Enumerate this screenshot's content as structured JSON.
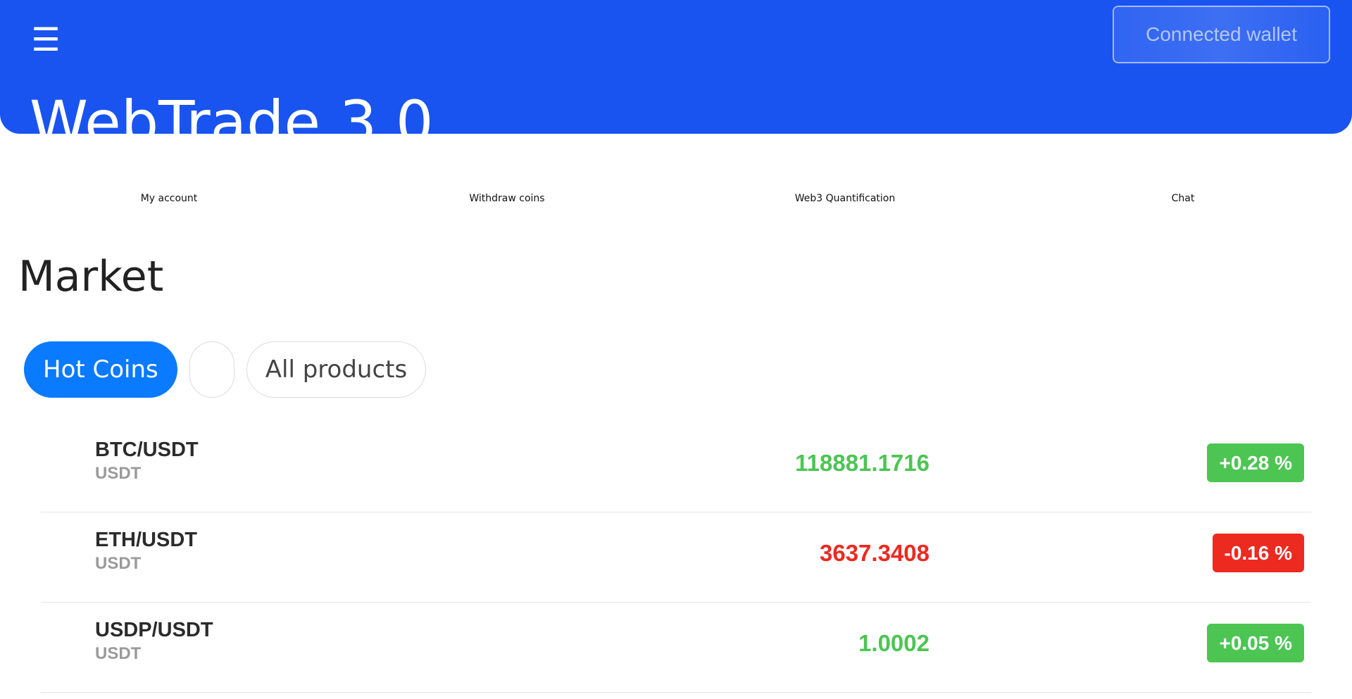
{
  "header": {
    "menu_icon": "☰",
    "wallet_button": "Connected wallet",
    "brand": "WebTrade 3.0",
    "color": "#1954f1"
  },
  "nav": {
    "items": [
      {
        "label": "My account"
      },
      {
        "label": "Withdraw coins"
      },
      {
        "label": "Web3 Quantification"
      },
      {
        "label": "Chat"
      }
    ]
  },
  "market": {
    "title": "Market",
    "tabs": [
      {
        "label": "Hot Coins",
        "active": true
      },
      {
        "label": "",
        "active": false
      },
      {
        "label": "All products",
        "active": false
      }
    ],
    "coins": [
      {
        "pair": "BTC/USDT",
        "quote": "USDT",
        "price": "118881.1716",
        "change": "+0.28 %",
        "direction": "up"
      },
      {
        "pair": "ETH/USDT",
        "quote": "USDT",
        "price": "3637.3408",
        "change": "-0.16 %",
        "direction": "down"
      },
      {
        "pair": "USDP/USDT",
        "quote": "USDT",
        "price": "1.0002",
        "change": "+0.05 %",
        "direction": "up"
      }
    ],
    "colors": {
      "up": "#4cc553",
      "down": "#ec2a20",
      "active_tab": "#0a7aff"
    }
  }
}
